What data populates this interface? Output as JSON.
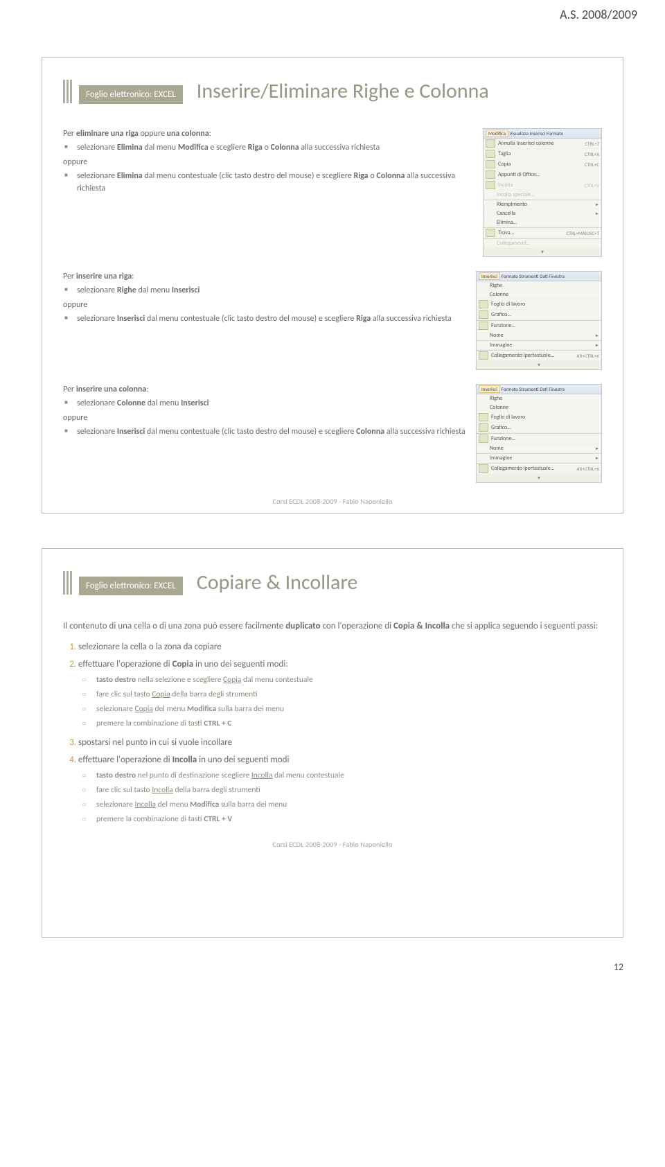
{
  "header_year": "A.S. 2008/2009",
  "page_number": "12",
  "footer": "Corsi ECDL 2008-2009 - Fabio Naponiello",
  "slide1": {
    "badge": "Foglio elettronico: EXCEL",
    "title": "Inserire/Eliminare Righe e Colonna",
    "sec1": {
      "lead": "Per eliminare una riga oppure una colonna:",
      "b1": "selezionare Elimina dal menu Modifica e scegliere Riga o Colonna alla successiva richiesta",
      "oppure": "oppure",
      "b2": "selezionare Elimina dal menu contestuale (clic tasto destro del mouse) e scegliere Riga o Colonna alla successiva richiesta"
    },
    "sec2": {
      "lead": "Per inserire una riga:",
      "b1": "selezionare Righe dal menu Inserisci",
      "oppure": "oppure",
      "b2": "selezionare Inserisci dal menu contestuale (clic tasto destro del mouse) e scegliere Riga alla successiva richiesta"
    },
    "sec3": {
      "lead": "Per inserire una colonna:",
      "b1": "selezionare Colonne dal menu Inserisci",
      "oppure": "oppure",
      "b2": "selezionare Inserisci dal menu contestuale (clic tasto destro del mouse) e scegliere Colonna alla successiva richiesta"
    },
    "mock_modifica": {
      "bar": {
        "m1": "Modifica",
        "m2": "Visualizza",
        "m3": "Inserisci",
        "m4": "Formato"
      },
      "r1": {
        "lbl": "Annulla Inserisci colonne",
        "shc": "CTRL+Z"
      },
      "r2": {
        "lbl": "Taglia",
        "shc": "CTRL+X"
      },
      "r3": {
        "lbl": "Copia",
        "shc": "CTRL+C"
      },
      "r4": {
        "lbl": "Appunti di Office…"
      },
      "r5": {
        "lbl": "Incolla",
        "shc": "CTRL+V"
      },
      "r6": {
        "lbl": "Incolla speciale…"
      },
      "r7": {
        "lbl": "Riempimento"
      },
      "r8": {
        "lbl": "Cancella"
      },
      "r9": {
        "lbl": "Elimina…"
      },
      "r10": {
        "lbl": "Trova…",
        "shc": "CTRL+MAIUSC+T"
      },
      "r11": {
        "lbl": "Collegamenti…"
      }
    },
    "mock_ins1": {
      "bar": {
        "m1": "Inserisci",
        "m2": "Formato",
        "m3": "Strumenti",
        "m4": "Dati",
        "m5": "Finestra"
      },
      "r1": "Righe",
      "r2": "Colonne",
      "r3": "Foglio di lavoro",
      "r4": "Grafico…",
      "r5": "Funzione…",
      "r6": "Nome",
      "r7": "Immagine",
      "r8": {
        "lbl": "Collegamento ipertestuale…",
        "shc": "Alt+CTRL+K"
      }
    },
    "mock_ins2": {
      "bar": {
        "m1": "Inserisci",
        "m2": "Formato",
        "m3": "Strumenti",
        "m4": "Dati",
        "m5": "Finestra"
      },
      "r1": "Righe",
      "r2": "Colonne",
      "r3": "Foglio di lavoro",
      "r4": "Grafico…",
      "r5": "Funzione…",
      "r6": "Nome",
      "r7": "Immagine",
      "r8": {
        "lbl": "Collegamento ipertestuale…",
        "shc": "Alt+CTRL+K"
      }
    }
  },
  "slide2": {
    "badge": "Foglio elettronico: EXCEL",
    "title": "Copiare & Incollare",
    "intro": "Il contenuto di una cella o di una zona può essere facilmente duplicato con l'operazione di Copia & Incolla che si applica seguendo i seguenti passi:",
    "step1": "selezionare la cella o la zona da copiare",
    "step2": "effettuare l'operazione di Copia in uno dei seguenti modi:",
    "s2a": "tasto destro nella selezione e scegliere Copia dal menu contestuale",
    "s2b": "fare clic sul tasto Copia della barra degli strumenti",
    "s2c": "selezionare Copia del menu Modifica sulla barra dei menu",
    "s2d": "premere la combinazione di tasti CTRL + C",
    "step3": "spostarsi nel punto in cui si vuole incollare",
    "step4": "effettuare l'operazione di Incolla in uno dei seguenti modi",
    "s4a": "tasto destro nel punto di destinazione scegliere Incolla dal menu contestuale",
    "s4b": "fare clic sul tasto Incolla della barra degli strumenti",
    "s4c": "selezionare Incolla del menu Modifica sulla barra dei menu",
    "s4d": "premere la combinazione di tasti CTRL + V"
  }
}
